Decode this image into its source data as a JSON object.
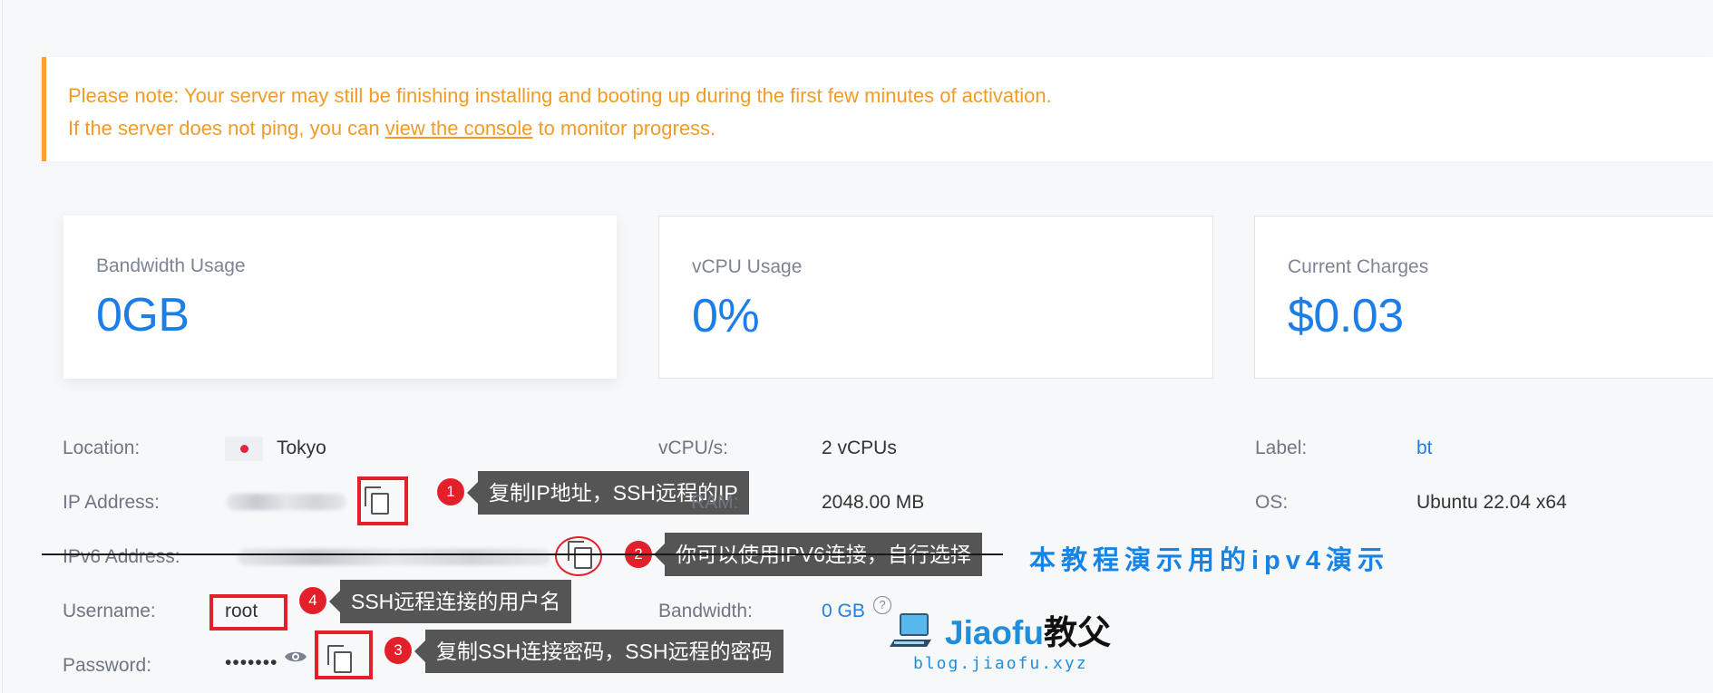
{
  "notice": {
    "line1": "Please note: Your server may still be finishing installing and booting up during the first few minutes of activation.",
    "line2_prefix": "If the server does not ping, you can ",
    "line2_link": "view the console",
    "line2_suffix": " to monitor progress."
  },
  "cards": [
    {
      "label": "Bandwidth Usage",
      "value": "0GB"
    },
    {
      "label": "vCPU Usage",
      "value": "0%"
    },
    {
      "label": "Current Charges",
      "value": "$0.03"
    }
  ],
  "details": {
    "location": {
      "label": "Location:",
      "value": "Tokyo"
    },
    "ip_address": {
      "label": "IP Address:"
    },
    "ipv6_address": {
      "label": "IPv6 Address:"
    },
    "username": {
      "label": "Username:",
      "value": "root"
    },
    "password": {
      "label": "Password:",
      "value": "•••••••"
    },
    "vcpus": {
      "label": "vCPU/s:",
      "value": "2 vCPUs"
    },
    "ram": {
      "label": "RAM:",
      "value": "2048.00 MB"
    },
    "bandwidth": {
      "label": "Bandwidth:",
      "value": "0 GB",
      "help": "?"
    },
    "server_label": {
      "label": "Label:",
      "value": "bt"
    },
    "os": {
      "label": "OS:",
      "value": "Ubuntu 22.04 x64"
    }
  },
  "annotations": [
    {
      "number": "1",
      "text": "复制IP地址，SSH远程的IP"
    },
    {
      "number": "2",
      "text": "你可以使用IPV6连接，自行选择"
    },
    {
      "number": "3",
      "text": "复制SSH连接密码，SSH远程的密码"
    },
    {
      "number": "4",
      "text": "SSH远程连接的用户名"
    }
  ],
  "blue_note": "本教程演示用的ipv4演示",
  "brand": {
    "name_en": "Jiaofu",
    "name_cn": "教父",
    "site": "blog.jiaofu.xyz"
  },
  "colors": {
    "accent": "#1e7ee8",
    "warning": "#f29b27",
    "annotation": "#e3202a"
  },
  "icons": [
    "copy-icon",
    "eye-icon",
    "help-icon",
    "laptop-icon",
    "flag-japan-icon"
  ]
}
